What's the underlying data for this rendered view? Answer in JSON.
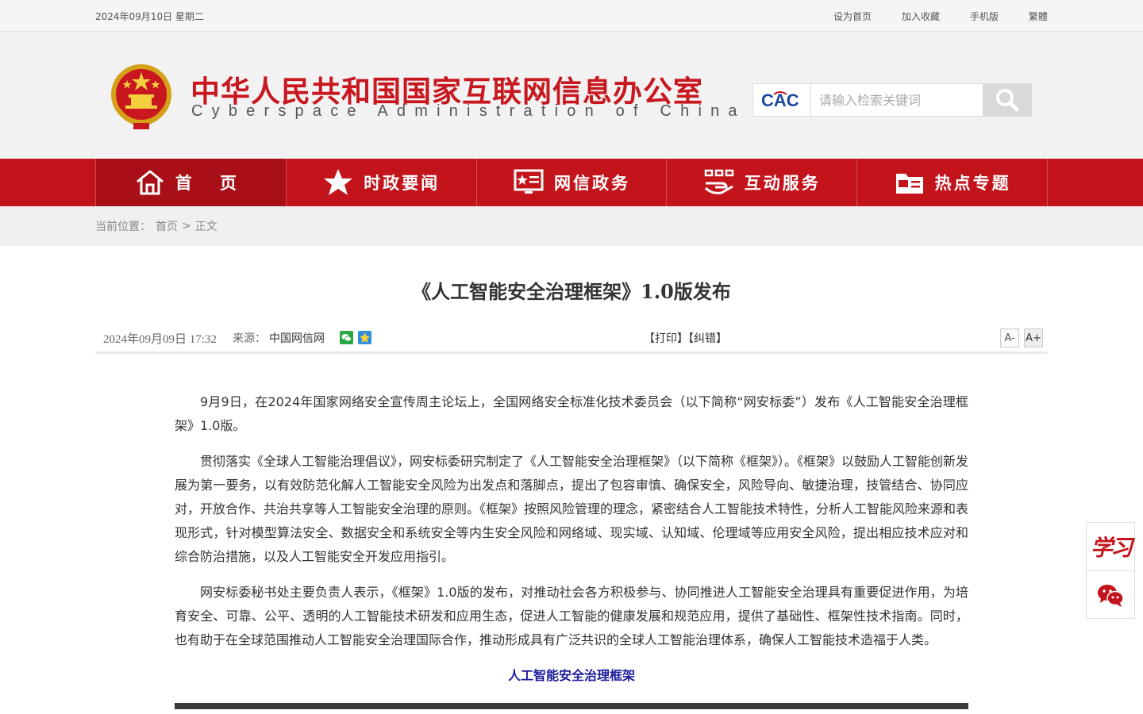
{
  "topbar": {
    "date": "2024年09月10日 星期二",
    "links": [
      "设为首页",
      "加入收藏",
      "手机版",
      "繁體"
    ]
  },
  "header": {
    "title": "中华人民共和国国家互联网信息办公室",
    "subtitle": "Cyberspace Administration of China",
    "search_logo": "CAC",
    "search_placeholder": "请输入检索关键词"
  },
  "nav": {
    "items": [
      {
        "label": "首 页",
        "icon": "home-icon"
      },
      {
        "label": "时政要闻",
        "icon": "star-icon"
      },
      {
        "label": "网信政务",
        "icon": "monitor-icon"
      },
      {
        "label": "互动服务",
        "icon": "hands-icon"
      },
      {
        "label": "热点专题",
        "icon": "folder-icon"
      }
    ]
  },
  "breadcrumb": {
    "prefix": "当前位置：",
    "home": "首页",
    "separator": ">",
    "current": "正文"
  },
  "article": {
    "title": "《人工智能安全治理框架》1.0版发布",
    "date": "2024年09月09日 17:32",
    "source_label": "来源：",
    "source": "中国网信网",
    "print": "【打印】",
    "correct": "【纠错】",
    "font_smaller": "A-",
    "font_larger": "A+",
    "paragraphs": [
      "9月9日，在2024年国家网络安全宣传周主论坛上，全国网络安全标准化技术委员会（以下简称“网安标委”）发布《人工智能安全治理框架》1.0版。",
      "贯彻落实《全球人工智能治理倡议》，网安标委研究制定了《人工智能安全治理框架》（以下简称《框架》）。《框架》以鼓励人工智能创新发展为第一要务，以有效防范化解人工智能安全风险为出发点和落脚点，提出了包容审慎、确保安全，风险导向、敏捷治理，技管结合、协同应对，开放合作、共治共享等人工智能安全治理的原则。《框架》按照风险管理的理念，紧密结合人工智能技术特性，分析人工智能风险来源和表现形式，针对模型算法安全、数据安全和系统安全等内生安全风险和网络域、现实域、认知域、伦理域等应用安全风险，提出相应技术应对和综合防治措施，以及人工智能安全开发应用指引。",
      "网安标委秘书处主要负责人表示，《框架》1.0版的发布，对推动社会各方积极参与、协同推进人工智能安全治理具有重要促进作用，为培育安全、可靠、公平、透明的人工智能技术研发和应用生态，促进人工智能的健康发展和规范应用，提供了基础性、框架性技术指南。同时，也有助于在全球范围推动人工智能安全治理国际合作，推动形成具有广泛共识的全球人工智能治理体系，确保人工智能技术造福于人类。"
    ],
    "caption": "人工智能安全治理框架"
  },
  "side": {
    "xuexi": "学习",
    "wechat_icon": "wechat-icon"
  },
  "colors": {
    "brand_red": "#c3141c",
    "nav_active": "#a80f16",
    "caption_blue": "#1a1a9c"
  }
}
